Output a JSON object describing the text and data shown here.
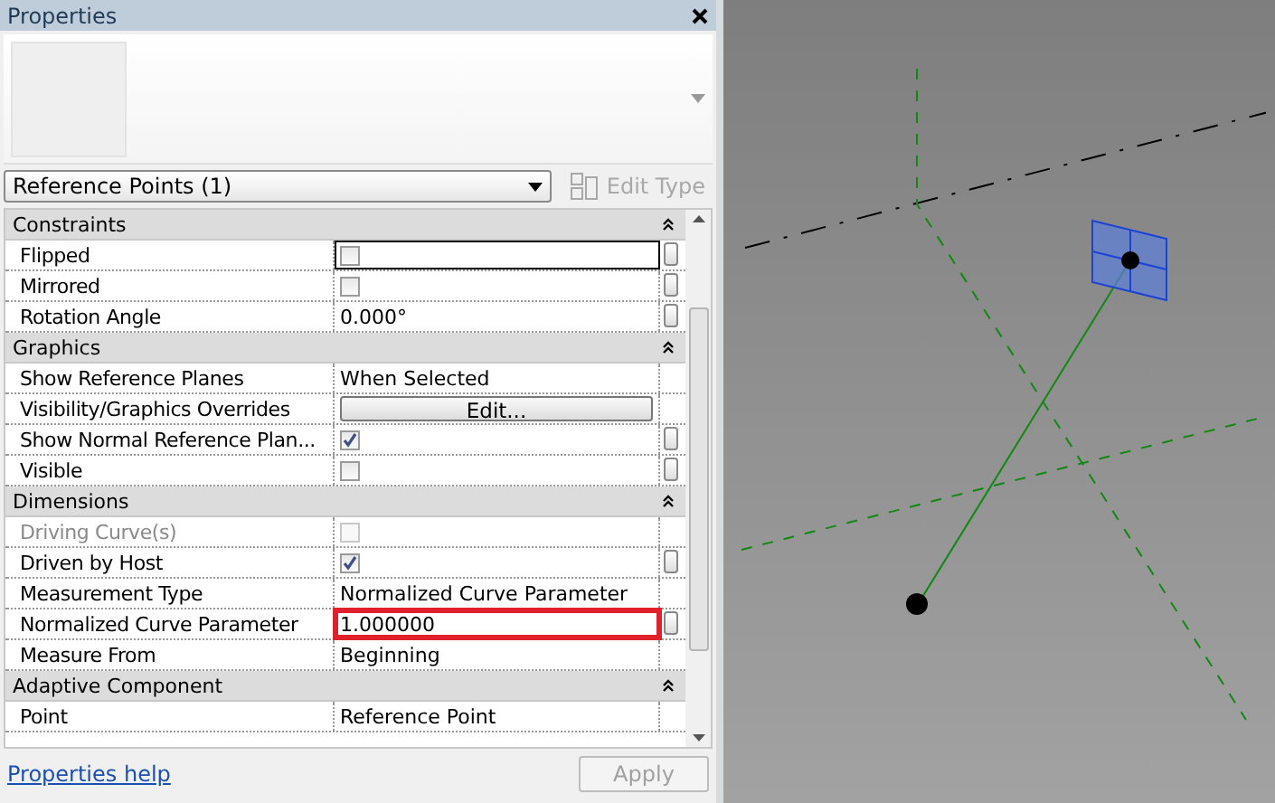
{
  "window": {
    "title": "Properties"
  },
  "type_selector": {
    "value": "Reference Points (1)"
  },
  "edit_type": {
    "label": "Edit Type",
    "disabled": true
  },
  "groups": [
    {
      "name": "Constraints",
      "expanded": true,
      "rows": [
        {
          "label": "Flipped",
          "kind": "checkbox",
          "checked": false,
          "disabled": false,
          "selected": true,
          "highlighted": false,
          "linkable": true
        },
        {
          "label": "Mirrored",
          "kind": "checkbox",
          "checked": false,
          "disabled": false,
          "selected": false,
          "highlighted": false,
          "linkable": true
        },
        {
          "label": "Rotation Angle",
          "kind": "text",
          "value": "0.000°",
          "disabled": false,
          "selected": false,
          "highlighted": false,
          "linkable": true
        }
      ]
    },
    {
      "name": "Graphics",
      "expanded": true,
      "rows": [
        {
          "label": "Show Reference Planes",
          "kind": "text",
          "value": "When Selected",
          "disabled": false,
          "selected": false,
          "highlighted": false,
          "linkable": false
        },
        {
          "label": "Visibility/Graphics Overrides",
          "kind": "button",
          "value": "Edit...",
          "disabled": false,
          "selected": false,
          "highlighted": false,
          "linkable": false
        },
        {
          "label": "Show Normal Reference Plan...",
          "kind": "checkbox",
          "checked": true,
          "disabled": false,
          "selected": false,
          "highlighted": false,
          "linkable": true
        },
        {
          "label": "Visible",
          "kind": "checkbox",
          "checked": false,
          "disabled": false,
          "selected": false,
          "highlighted": false,
          "linkable": true
        }
      ]
    },
    {
      "name": "Dimensions",
      "expanded": true,
      "rows": [
        {
          "label": "Driving Curve(s)",
          "kind": "checkbox",
          "checked": false,
          "disabled": true,
          "selected": false,
          "highlighted": false,
          "linkable": false
        },
        {
          "label": "Driven by Host",
          "kind": "checkbox",
          "checked": true,
          "disabled": false,
          "selected": false,
          "highlighted": false,
          "linkable": true
        },
        {
          "label": "Measurement Type",
          "kind": "text",
          "value": "Normalized Curve Parameter",
          "disabled": false,
          "selected": false,
          "highlighted": false,
          "linkable": false
        },
        {
          "label": "Normalized Curve Parameter",
          "kind": "text",
          "value": "1.000000",
          "disabled": false,
          "selected": false,
          "highlighted": true,
          "linkable": true
        },
        {
          "label": "Measure From",
          "kind": "text",
          "value": "Beginning",
          "disabled": false,
          "selected": false,
          "highlighted": false,
          "linkable": false
        }
      ]
    },
    {
      "name": "Adaptive Component",
      "expanded": true,
      "rows": [
        {
          "label": "Point",
          "kind": "text",
          "value": "Reference Point",
          "disabled": false,
          "selected": false,
          "highlighted": false,
          "linkable": false
        }
      ]
    }
  ],
  "help_link": "Properties help",
  "apply_button": {
    "label": "Apply",
    "disabled": true
  }
}
